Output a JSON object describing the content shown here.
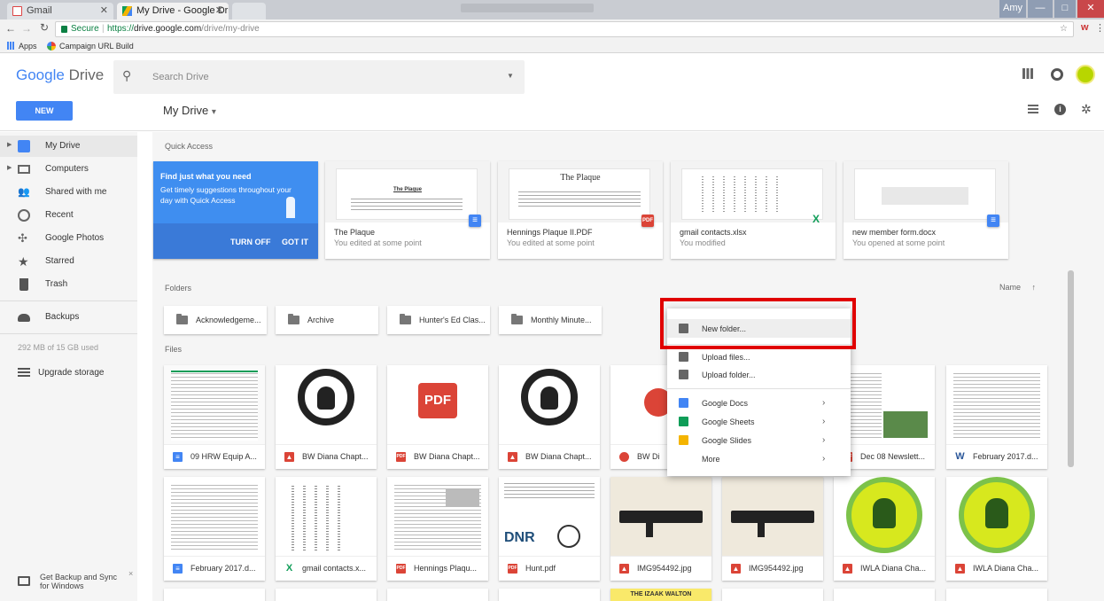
{
  "browser": {
    "tabs": [
      {
        "label": "Gmail"
      },
      {
        "label": "My Drive - Google Drive"
      }
    ],
    "address": {
      "secure_label": "Secure",
      "url_prefix": "https://",
      "url_host": "drive.google.com",
      "url_path": "/drive/my-drive"
    },
    "bookmarks": [
      {
        "label": "Apps"
      },
      {
        "label": "Campaign URL Build"
      }
    ],
    "window_buttons": {
      "user": "Amy",
      "min": "—",
      "max": "□",
      "close": "✕"
    }
  },
  "header": {
    "logo_google": "Google",
    "logo_drive": "Drive",
    "search_placeholder": "Search Drive"
  },
  "toolbar": {
    "new_label": "NEW",
    "title": "My Drive",
    "title_caret": "▾"
  },
  "sidebar": {
    "items": [
      {
        "label": "My Drive",
        "icon": "drive-icon"
      },
      {
        "label": "Computers",
        "icon": "computer-icon"
      },
      {
        "label": "Shared with me",
        "icon": "people-icon"
      },
      {
        "label": "Recent",
        "icon": "clock-icon"
      },
      {
        "label": "Google Photos",
        "icon": "pinwheel-icon"
      },
      {
        "label": "Starred",
        "icon": "star-icon"
      },
      {
        "label": "Trash",
        "icon": "trash-icon"
      },
      {
        "label": "Backups",
        "icon": "cloud-icon"
      }
    ],
    "storage": "292 MB of 15 GB used",
    "upgrade": "Upgrade storage",
    "backup_sync": "Get Backup and Sync for Windows"
  },
  "main": {
    "quick_access_label": "Quick Access",
    "promo": {
      "title": "Find just what you need",
      "body": "Get timely suggestions throughout your day with Quick Access",
      "turn_off": "TURN OFF",
      "got_it": "GOT IT"
    },
    "quick_access": [
      {
        "name": "The Plaque",
        "sub": "You edited at some point",
        "thumb_title": "The Plaque",
        "type": "doc"
      },
      {
        "name": "Hennings Plaque II.PDF",
        "sub": "You edited at some point",
        "thumb_title": "The Plaque",
        "type": "pdf"
      },
      {
        "name": "gmail contacts.xlsx",
        "sub": "You modified",
        "thumb_title": "",
        "type": "sheet"
      },
      {
        "name": "new member form.docx",
        "sub": "You opened at some point",
        "thumb_title": "",
        "type": "doc"
      }
    ],
    "folders_label": "Folders",
    "sort_label": "Name",
    "sort_arrow": "↑",
    "folders": [
      {
        "name": "Acknowledgeme..."
      },
      {
        "name": "Archive"
      },
      {
        "name": "Hunter's Ed Clas..."
      },
      {
        "name": "Monthly Minute..."
      }
    ],
    "files_label": "Files",
    "files_row1": [
      {
        "name": "09 HRW Equip A...",
        "type": "doc"
      },
      {
        "name": "BW Diana Chapt...",
        "type": "image"
      },
      {
        "name": "BW Diana Chapt...",
        "type": "pdf"
      },
      {
        "name": "BW Diana Chapt...",
        "type": "image"
      },
      {
        "name": "BW Di",
        "type": "drawing"
      },
      {
        "name": "Dec 08 Newslett...",
        "type": "pdf"
      },
      {
        "name": "February 2017.d...",
        "type": "word"
      }
    ],
    "files_row2": [
      {
        "name": "February 2017.d...",
        "type": "doc"
      },
      {
        "name": "gmail contacts.x...",
        "type": "excel"
      },
      {
        "name": "Hennings Plaqu...",
        "type": "pdf"
      },
      {
        "name": "Hunt.pdf",
        "type": "pdf"
      },
      {
        "name": "IMG954492.jpg",
        "type": "image"
      },
      {
        "name": "IMG954492.jpg",
        "type": "image"
      },
      {
        "name": "IWLA Diana Cha...",
        "type": "image"
      },
      {
        "name": "IWLA Diana Cha...",
        "type": "image"
      }
    ],
    "pdf_thumb_label": "PDF",
    "dnr_label": "DNR",
    "bottom_thumb_text": "THE IZAAK WALTON"
  },
  "context_menu": {
    "items": [
      {
        "label": "New folder...",
        "icon": "new-folder-icon",
        "submenu": false
      },
      {
        "label": "Upload files...",
        "icon": "upload-file-icon",
        "submenu": false
      },
      {
        "label": "Upload folder...",
        "icon": "upload-folder-icon",
        "submenu": false
      },
      {
        "label": "Google Docs",
        "icon": "docs-icon",
        "submenu": true
      },
      {
        "label": "Google Sheets",
        "icon": "sheets-icon",
        "submenu": true
      },
      {
        "label": "Google Slides",
        "icon": "slides-icon",
        "submenu": true
      },
      {
        "label": "More",
        "icon": "",
        "submenu": true
      }
    ],
    "submenu_arrow": "›"
  },
  "colors": {
    "accent_blue": "#4285f4",
    "promo_blue": "#3f8ef0",
    "highlight_red": "#e00000",
    "docs": "#4285f4",
    "sheets": "#0f9d58",
    "slides": "#f4b400",
    "pdf": "#db4437"
  }
}
